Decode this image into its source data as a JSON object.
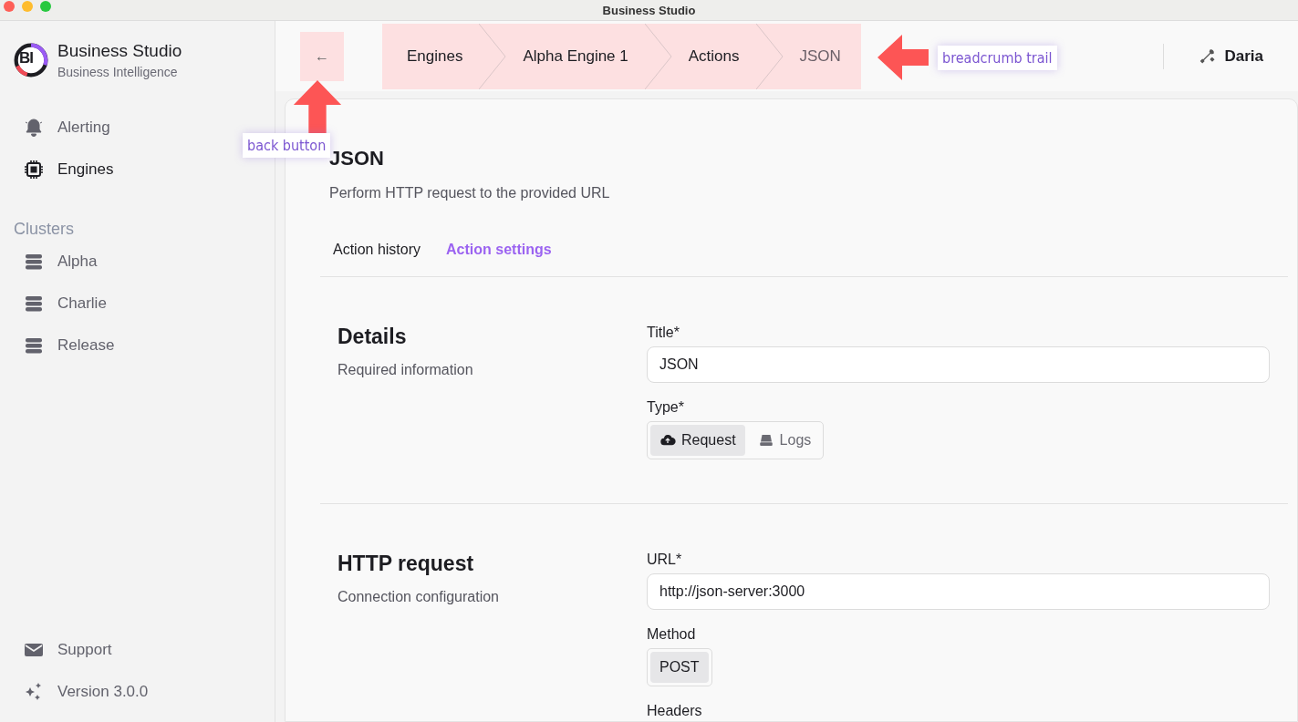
{
  "window": {
    "title": "Business Studio"
  },
  "brand": {
    "name": "Business Studio",
    "subtitle": "Business Intelligence",
    "logo_text": "BI"
  },
  "nav": [
    {
      "label": "Alerting",
      "selected": false
    },
    {
      "label": "Engines",
      "selected": true
    }
  ],
  "clusters": {
    "heading": "Clusters",
    "items": [
      {
        "label": "Alpha"
      },
      {
        "label": "Charlie"
      },
      {
        "label": "Release"
      }
    ]
  },
  "footer_nav": [
    {
      "label": "Support"
    },
    {
      "label": "Version 3.0.0"
    }
  ],
  "header": {
    "back_glyph": "←",
    "breadcrumbs": [
      {
        "label": "Engines",
        "current": false
      },
      {
        "label": "Alpha Engine 1",
        "current": false
      },
      {
        "label": "Actions",
        "current": false
      },
      {
        "label": "JSON",
        "current": true
      }
    ],
    "user": "Daria"
  },
  "annotations": [
    {
      "label": "back button",
      "kind": "below"
    },
    {
      "label": "breadcrumb trail",
      "kind": "beside"
    }
  ],
  "page": {
    "title": "JSON",
    "description": "Perform HTTP request to the provided URL",
    "tabs": [
      {
        "label": "Action history",
        "selected": false
      },
      {
        "label": "Action settings",
        "selected": true
      }
    ],
    "sections": [
      {
        "title": "Details",
        "subtitle": "Required information",
        "fields": [
          {
            "kind": "text",
            "label": "Title*",
            "value": "JSON"
          },
          {
            "kind": "segmented",
            "label": "Type*",
            "options": [
              {
                "label": "Request",
                "selected": true
              },
              {
                "label": "Logs",
                "selected": false
              }
            ]
          }
        ]
      },
      {
        "title": "HTTP request",
        "subtitle": "Connection configuration",
        "fields": [
          {
            "kind": "text",
            "label": "URL*",
            "value": "http://json-server:3000"
          },
          {
            "kind": "segmented",
            "label": "Method",
            "options": [
              {
                "label": "POST",
                "selected": true
              }
            ]
          },
          {
            "kind": "label",
            "label": "Headers"
          }
        ]
      }
    ]
  }
}
